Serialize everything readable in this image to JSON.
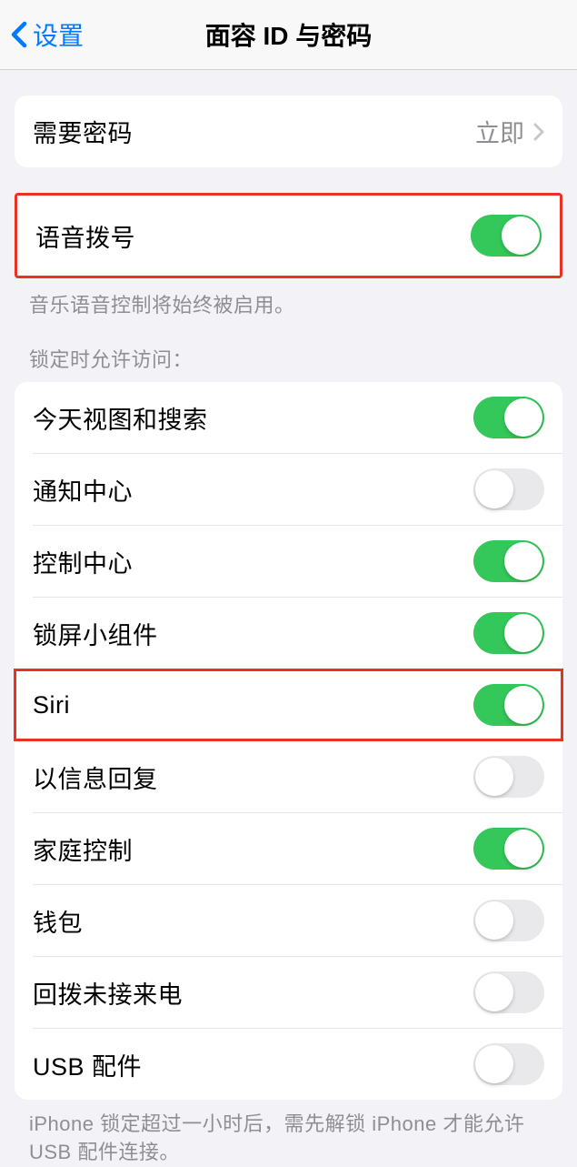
{
  "nav": {
    "back_label": "设置",
    "title": "面容 ID 与密码"
  },
  "require_passcode": {
    "label": "需要密码",
    "value": "立即"
  },
  "voice_dial": {
    "label": "语音拨号",
    "enabled": true,
    "footer": "音乐语音控制将始终被启用。"
  },
  "lock_access": {
    "header": "锁定时允许访问：",
    "items": [
      {
        "label": "今天视图和搜索",
        "enabled": true
      },
      {
        "label": "通知中心",
        "enabled": false
      },
      {
        "label": "控制中心",
        "enabled": true
      },
      {
        "label": "锁屏小组件",
        "enabled": true
      },
      {
        "label": "Siri",
        "enabled": true
      },
      {
        "label": "以信息回复",
        "enabled": false
      },
      {
        "label": "家庭控制",
        "enabled": true
      },
      {
        "label": "钱包",
        "enabled": false
      },
      {
        "label": "回拨未接来电",
        "enabled": false
      },
      {
        "label": "USB 配件",
        "enabled": false
      }
    ],
    "footer": "iPhone 锁定超过一小时后，需先解锁 iPhone 才能允许USB 配件连接。"
  }
}
